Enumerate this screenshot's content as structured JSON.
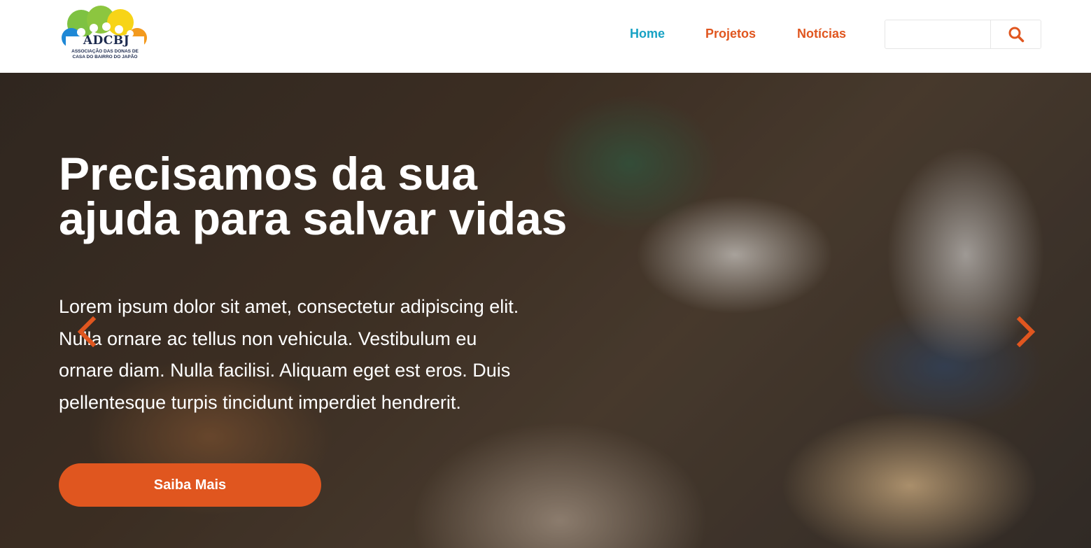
{
  "brand": {
    "logo_text": "ADCBJ",
    "logo_subtitle_line1": "ASSOCIAÇÃO DAS DONAS DE",
    "logo_subtitle_line2": "CASA DO BAIRRO DO JAPÃO"
  },
  "nav": {
    "items": [
      {
        "label": "Home",
        "active": true
      },
      {
        "label": "Projetos",
        "active": false
      },
      {
        "label": "Notícias",
        "active": false
      }
    ],
    "active_color": "#17a2c4",
    "link_color": "#e0561f"
  },
  "search": {
    "placeholder": "",
    "value": "",
    "icon": "search-icon"
  },
  "hero": {
    "title_line1": "Precisamos da sua",
    "title_line2": "ajuda para salvar vidas",
    "text_line1": "Lorem ipsum dolor sit amet, consectetur adipiscing elit.",
    "text_line2": "Nulla ornare ac tellus non vehicula. Vestibulum eu",
    "text_line3": "ornare diam. Nulla facilisi. Aliquam eget est eros. Duis",
    "text_line4": "pellentesque turpis tincidunt imperdiet hendrerit.",
    "cta_label": "Saiba Mais",
    "cta_color": "#e0561f",
    "prev_icon": "chevron-left-icon",
    "next_icon": "chevron-right-icon"
  }
}
